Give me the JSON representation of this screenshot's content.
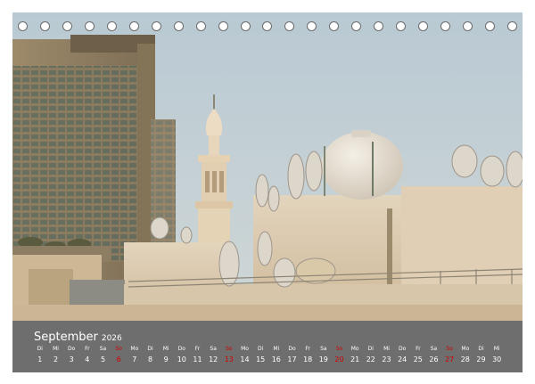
{
  "calendar": {
    "month": "September",
    "year": "2026",
    "days": [
      {
        "n": "Di",
        "d": "1"
      },
      {
        "n": "Mi",
        "d": "2"
      },
      {
        "n": "Do",
        "d": "3"
      },
      {
        "n": "Fr",
        "d": "4"
      },
      {
        "n": "Sa",
        "d": "5"
      },
      {
        "n": "So",
        "d": "6",
        "sunday": true
      },
      {
        "n": "Mo",
        "d": "7"
      },
      {
        "n": "Di",
        "d": "8"
      },
      {
        "n": "Mi",
        "d": "9"
      },
      {
        "n": "Do",
        "d": "10"
      },
      {
        "n": "Fr",
        "d": "11"
      },
      {
        "n": "Sa",
        "d": "12"
      },
      {
        "n": "So",
        "d": "13",
        "sunday": true
      },
      {
        "n": "Mo",
        "d": "14"
      },
      {
        "n": "Di",
        "d": "15"
      },
      {
        "n": "Mi",
        "d": "16"
      },
      {
        "n": "Do",
        "d": "17"
      },
      {
        "n": "Fr",
        "d": "18"
      },
      {
        "n": "Sa",
        "d": "19"
      },
      {
        "n": "So",
        "d": "20",
        "sunday": true
      },
      {
        "n": "Mo",
        "d": "21"
      },
      {
        "n": "Di",
        "d": "22"
      },
      {
        "n": "Mi",
        "d": "23"
      },
      {
        "n": "Do",
        "d": "24"
      },
      {
        "n": "Fr",
        "d": "25"
      },
      {
        "n": "Sa",
        "d": "26"
      },
      {
        "n": "So",
        "d": "27",
        "sunday": true
      },
      {
        "n": "Mo",
        "d": "28"
      },
      {
        "n": "Di",
        "d": "29"
      },
      {
        "n": "Mi",
        "d": "30"
      }
    ]
  },
  "colors": {
    "sunday": "#d40000",
    "calendar_bar": "#6e6e6e"
  }
}
